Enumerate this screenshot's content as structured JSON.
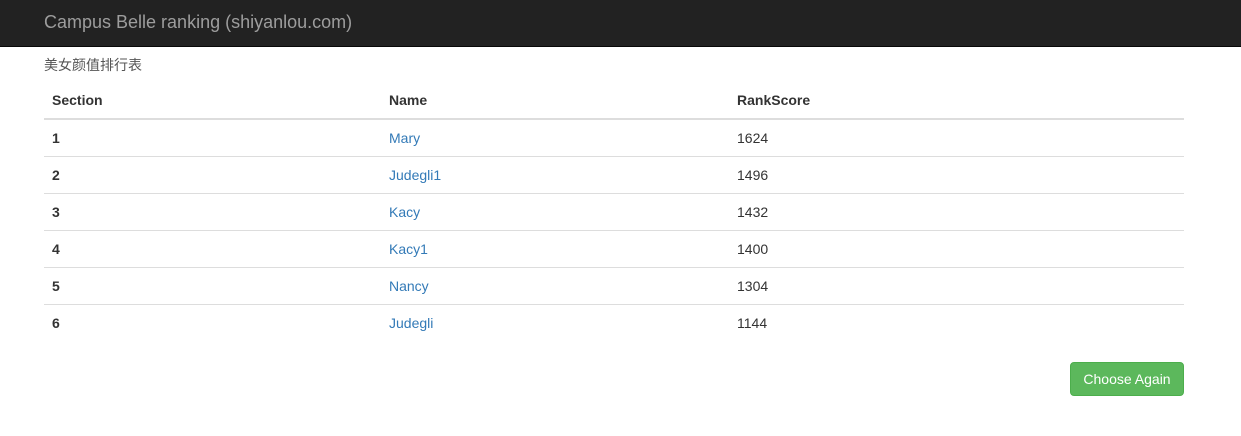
{
  "navbar": {
    "brand": "Campus Belle ranking (shiyanlou.com)"
  },
  "subtitle": "美女颜值排行表",
  "table": {
    "headers": [
      "Section",
      "Name",
      "RankScore"
    ],
    "rows": [
      {
        "section": "1",
        "name": "Mary",
        "score": "1624"
      },
      {
        "section": "2",
        "name": "Judegli1",
        "score": "1496"
      },
      {
        "section": "3",
        "name": "Kacy",
        "score": "1432"
      },
      {
        "section": "4",
        "name": "Kacy1",
        "score": "1400"
      },
      {
        "section": "5",
        "name": "Nancy",
        "score": "1304"
      },
      {
        "section": "6",
        "name": "Judegli",
        "score": "1144"
      }
    ]
  },
  "actions": {
    "choose_again_label": "Choose Again"
  },
  "colors": {
    "navbar_bg": "#222222",
    "link": "#337ab7",
    "success_button": "#5cb85c"
  }
}
